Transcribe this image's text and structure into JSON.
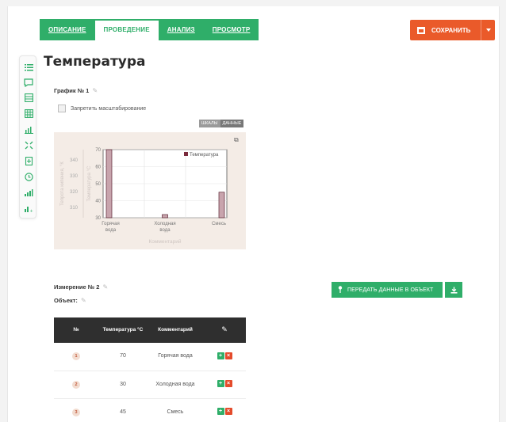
{
  "tabs": [
    {
      "label": "ОПИСАНИЕ"
    },
    {
      "label": "ПРОВЕДЕНИЕ"
    },
    {
      "label": "АНАЛИЗ"
    },
    {
      "label": "ПРОСМОТР"
    }
  ],
  "toolbar": {
    "save_label": "СОХРАНИТЬ"
  },
  "page_title": "Температура",
  "graph": {
    "title": "График № 1",
    "checkbox_label": "Запретить масштабирование",
    "view_tabs": [
      "ШКАЛЫ",
      "ДАННЫЕ"
    ]
  },
  "chart_data": {
    "type": "bar",
    "categories": [
      "Горячая вода",
      "Холодная вода",
      "Смесь"
    ],
    "series": [
      {
        "name": "Температура",
        "values": [
          70,
          30,
          45
        ]
      }
    ],
    "xlabel": "Комментарий",
    "ylabel_right": "Температура °С",
    "ylabel_left": "Тепрота кипения, °К",
    "ylim": [
      30,
      70
    ],
    "yticks": [
      30,
      40,
      50,
      60,
      70
    ],
    "y2ticks": [
      310,
      320,
      330,
      340
    ],
    "legend": "top-right",
    "grid": true,
    "colors": {
      "bar": "#c8a4ad",
      "bar_edge": "#5b2433",
      "legend_swatch": "#7a2a3c"
    }
  },
  "measurement": {
    "title": "Измерение № 2",
    "object_label": "Объект:",
    "send_label": "ПЕРЕДАТЬ ДАННЫЕ В ОБЪЕКТ"
  },
  "table": {
    "headers": [
      "№",
      "Температура °С",
      "Комментарий"
    ],
    "rows": [
      {
        "n": "1",
        "temp": "70",
        "comment": "Горячая вода"
      },
      {
        "n": "2",
        "temp": "30",
        "comment": "Холодная вода"
      },
      {
        "n": "3",
        "temp": "45",
        "comment": "Смесь"
      }
    ]
  },
  "colors": {
    "accent": "#2fae69",
    "save": "#ea5a2a",
    "table_header": "#2f2f2f"
  }
}
